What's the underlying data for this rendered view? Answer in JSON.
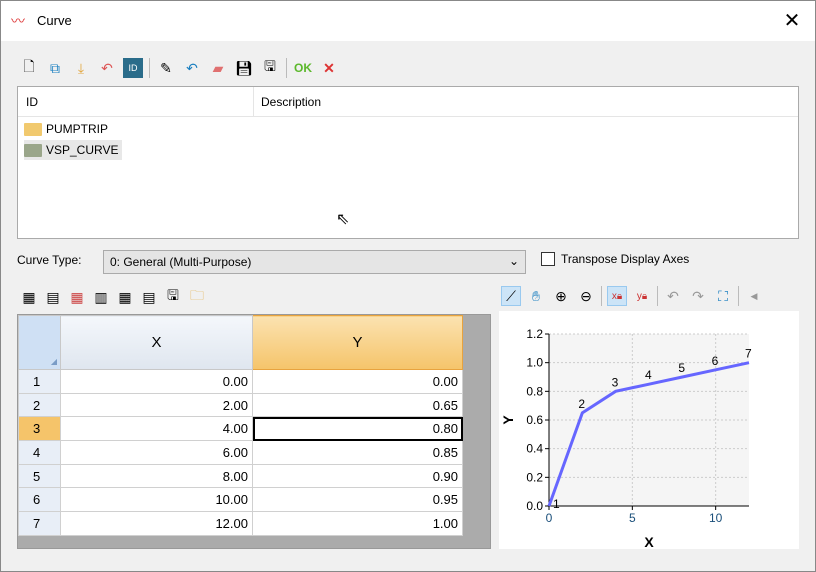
{
  "window": {
    "title": "Curve",
    "close": "✕"
  },
  "toolbar": {
    "ok_label": "OK",
    "cancel_label": "✕",
    "icons": [
      "new-icon",
      "copy-icon",
      "import-icon",
      "rename-icon",
      "id-icon",
      "edit-icon",
      "undo-icon",
      "erase-icon",
      "save-icon",
      "save-new-icon"
    ]
  },
  "list": {
    "columns": [
      "ID",
      "Description"
    ],
    "items": [
      {
        "id": "PUMPTRIP"
      },
      {
        "id": "VSP_CURVE"
      }
    ]
  },
  "curve_type": {
    "label": "Curve Type:",
    "value": "0: General (Multi-Purpose)"
  },
  "transpose": {
    "label": "Transpose Display Axes",
    "checked": false
  },
  "table": {
    "headers": [
      "X",
      "Y"
    ],
    "selected_row": 3,
    "rows": [
      [
        "1",
        "0.00",
        "0.00"
      ],
      [
        "2",
        "2.00",
        "0.65"
      ],
      [
        "3",
        "4.00",
        "0.80"
      ],
      [
        "4",
        "6.00",
        "0.85"
      ],
      [
        "5",
        "8.00",
        "0.90"
      ],
      [
        "6",
        "10.00",
        "0.95"
      ],
      [
        "7",
        "12.00",
        "1.00"
      ]
    ]
  },
  "chart_data": {
    "type": "line",
    "xlabel": "X",
    "ylabel": "Y",
    "xlim": [
      0,
      12
    ],
    "ylim": [
      0,
      1.2
    ],
    "xticks": [
      "0",
      "5",
      "10"
    ],
    "yticks": [
      "0.0",
      "0.2",
      "0.4",
      "0.6",
      "0.8",
      "1.0",
      "1.2"
    ],
    "x": [
      0,
      2,
      4,
      6,
      8,
      10,
      12
    ],
    "y": [
      0,
      0.65,
      0.8,
      0.85,
      0.9,
      0.95,
      1.0
    ],
    "point_labels": [
      "1",
      "2",
      "3",
      "4",
      "5",
      "6",
      "7"
    ],
    "color": "#6666ff",
    "grid": true
  }
}
